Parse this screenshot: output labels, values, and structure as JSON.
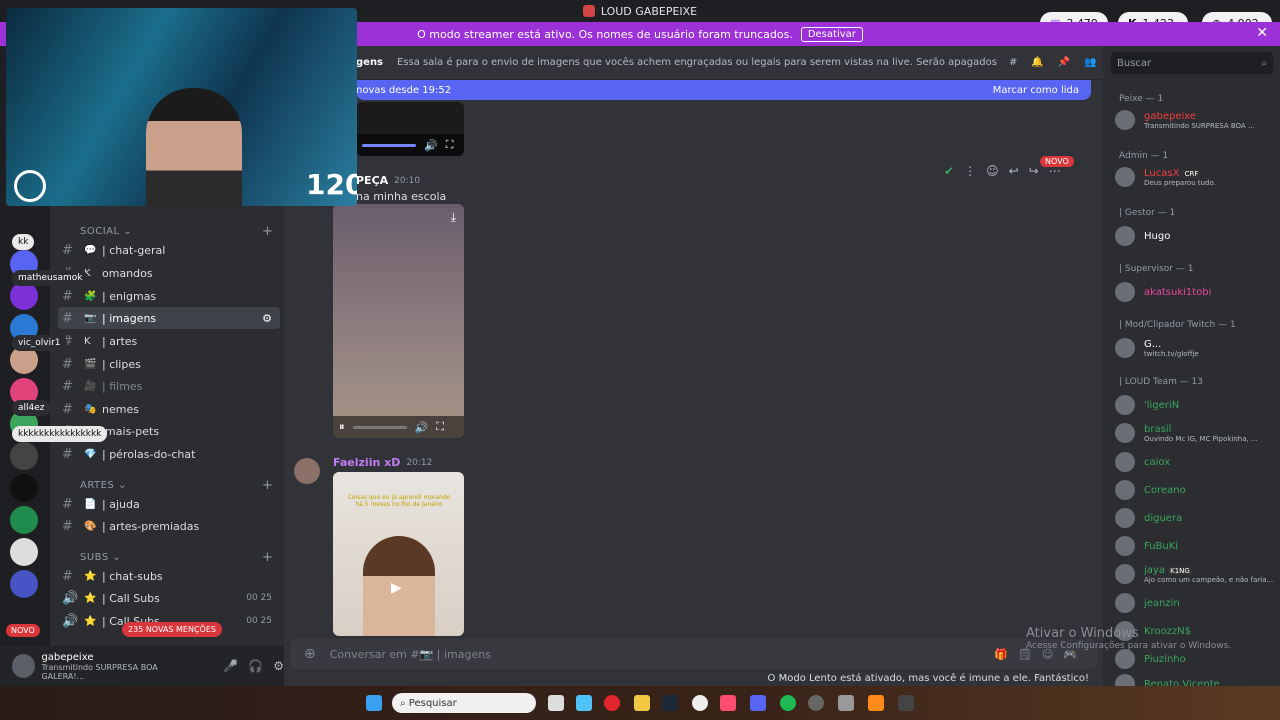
{
  "window": {
    "title": "LOUD GABEPEIXE"
  },
  "streamer_banner": {
    "text": "O modo streamer está ativo. Os nomes de usuário foram truncados.",
    "button": "Desativar"
  },
  "stats": [
    {
      "icon": "twitch-icon",
      "value": "3.479"
    },
    {
      "icon": "kick-icon",
      "value": "1.423"
    },
    {
      "icon": "globe-icon",
      "value": "4.902"
    }
  ],
  "webcam": {
    "timer": "120"
  },
  "channel_header": {
    "name": "imagens",
    "name_visible": "gens",
    "topic": "Essa sala é para o envio de imagens que vocês achem engraçadas ou legais para serem vistas na live. Serão apagados prints de outras redes sociais c..."
  },
  "new_messages": {
    "text": "novas desde 19:52",
    "action": "Marcar como lida"
  },
  "sidebar": {
    "categories": [
      {
        "label": "SOCIAL",
        "channels": [
          {
            "label": "| chat-geral",
            "emoji": "💬"
          },
          {
            "label": "omandos",
            "emoji": "K"
          },
          {
            "label": "| enigmas",
            "emoji": "🧩"
          },
          {
            "label": "| imagens",
            "emoji": "📷",
            "selected": true
          },
          {
            "label": "| artes",
            "emoji": "K"
          },
          {
            "label": "| clipes",
            "emoji": "🎬"
          },
          {
            "label": "| filmes",
            "emoji": "🎥"
          },
          {
            "label": "nemes",
            "emoji": "🎭"
          },
          {
            "label": "imais-pets",
            "emoji": "🐾"
          },
          {
            "label": "| pérolas-do-chat",
            "emoji": "💎"
          }
        ]
      },
      {
        "label": "ARTES",
        "channels": [
          {
            "label": "| ajuda",
            "emoji": "📄"
          },
          {
            "label": "| artes-premiadas",
            "emoji": "🎨"
          }
        ]
      },
      {
        "label": "SUBS",
        "channels": [
          {
            "label": "| chat-subs",
            "emoji": "⭐"
          },
          {
            "label": "| Call Subs",
            "emoji": "⭐",
            "count": [
              "00",
              "25"
            ]
          },
          {
            "label": "| Call Subs",
            "emoji": "⭐",
            "count": [
              "00",
              "25"
            ]
          }
        ]
      }
    ],
    "overlay_chat": [
      "kk",
      "matheusamok",
      "vic_olvir1",
      "all4ez",
      "kkkkkkkkkkkkkkkk"
    ]
  },
  "badges": {
    "novo": "NOVO",
    "mentions": "235 NOVAS MENÇÕES",
    "new_tag": "NOVO"
  },
  "messages": [
    {
      "author": "PEÇA",
      "time": "20:10",
      "text": "na minha escola"
    },
    {
      "author": "Faelziin xD",
      "time": "20:12",
      "overlay_text": "Coisas que eu já aprendi morando há 5 meses no Rio de Janeiro"
    }
  ],
  "composer": {
    "placeholder": "Conversar em #📷 | imagens"
  },
  "slow_mode": "O Modo Lento está ativado, mas você é imune a ele. Fantástico!",
  "user": {
    "name": "gabepeixe",
    "status": "Transmitindo SURPRESA BOA GALERA!..."
  },
  "members": {
    "search_placeholder": "Buscar",
    "groups": [
      {
        "role": "Peixe — 1",
        "users": [
          {
            "name": "gabepeixe",
            "status": "Transmitindo SURPRESA BOA ...",
            "color": "#f23f43"
          }
        ]
      },
      {
        "role": "Admin — 1",
        "users": [
          {
            "name": "LucasX",
            "status": "Deus preparou tudo.",
            "color": "#f23f43",
            "tag": "CRF"
          }
        ]
      },
      {
        "role": "| Gestor — 1",
        "users": [
          {
            "name": "Hugo",
            "status": "",
            "color": "#ffffff"
          }
        ]
      },
      {
        "role": "| Supervisor — 1",
        "users": [
          {
            "name": "akatsuki1tobi",
            "status": "",
            "color": "#eb459e"
          }
        ]
      },
      {
        "role": "| Mod/Clipador Twitch — 1",
        "users": [
          {
            "name": "G...",
            "status": "twitch.tv/gloffje",
            "color": "#ffffff"
          }
        ]
      },
      {
        "role": "| LOUD Team — 13",
        "users": [
          {
            "name": "'ligeriN",
            "status": "",
            "color": "#3ba55d"
          },
          {
            "name": "brasil",
            "status": "Ouvindo Mc IG, MC Pipokinha, ...",
            "color": "#3ba55d"
          },
          {
            "name": "caiox",
            "status": "",
            "color": "#3ba55d"
          },
          {
            "name": "Coreano",
            "status": "",
            "color": "#3ba55d"
          },
          {
            "name": "diguera",
            "status": "",
            "color": "#3ba55d"
          },
          {
            "name": "FuBuKi",
            "status": "",
            "color": "#3ba55d"
          },
          {
            "name": "jaya",
            "status": "Ajo como um campeão, e não faria...",
            "color": "#3ba55d",
            "tag": "K1NG"
          },
          {
            "name": "jeanzin",
            "status": "",
            "color": "#3ba55d"
          },
          {
            "name": "KroozzN$",
            "status": "",
            "color": "#3ba55d"
          },
          {
            "name": "Piuzinho",
            "status": "",
            "color": "#3ba55d"
          },
          {
            "name": "Renato Vicente",
            "status": "",
            "color": "#3ba55d"
          }
        ]
      }
    ]
  },
  "watermark": {
    "title": "Ativar o Windows",
    "subtitle": "Acesse Configurações para ativar o Windows."
  },
  "taskbar": {
    "search_placeholder": "Pesquisar"
  }
}
